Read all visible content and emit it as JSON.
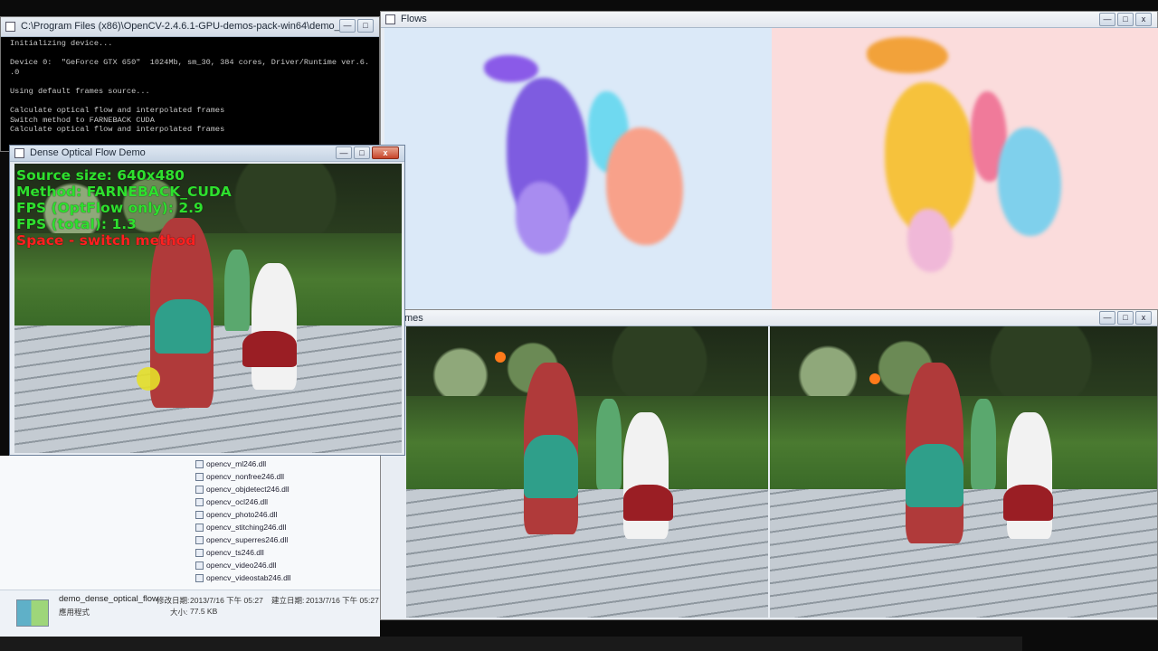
{
  "console": {
    "title": "C:\\Program Files (x86)\\OpenCV-2.4.6.1-GPU-demos-pack-win64\\demo_dense_optical_flow....",
    "lines": [
      "Initializing device...",
      "",
      "Device 0:  \"GeForce GTX 650\"  1024Mb, sm_30, 384 cores, Driver/Runtime ver.6.",
      ".0",
      "",
      "Using default frames source...",
      "",
      "Calculate optical flow and interpolated frames",
      "Switch method to FARNEBACK CUDA",
      "Calculate optical flow and interpolated frames"
    ]
  },
  "flows": {
    "title": "Flows"
  },
  "frames": {
    "title": "Frames",
    "title_visible": "mes"
  },
  "demo": {
    "title": "Dense Optical Flow Demo",
    "overlay": {
      "source_size": "Source size: 640x480",
      "method": "Method: FARNEBACK_CUDA",
      "fps_optflow": "FPS (OptFlow only): 2.9",
      "fps_total": "FPS (total): 1.3",
      "hint": "Space - switch method"
    }
  },
  "explorer": {
    "files": [
      "opencv_ml246.dll",
      "opencv_nonfree246.dll",
      "opencv_objdetect246.dll",
      "opencv_ocl246.dll",
      "opencv_photo246.dll",
      "opencv_stitching246.dll",
      "opencv_superres246.dll",
      "opencv_ts246.dll",
      "opencv_video246.dll",
      "opencv_videostab246.dll"
    ],
    "details": {
      "name": "demo_dense_optical_flow",
      "type": "應用程式",
      "modified_label": "修改日期:",
      "modified_value": "2013/7/16 下午 05:27",
      "created_label": "建立日期:",
      "created_value": "2013/7/16 下午 05:27",
      "size_label": "大小:",
      "size_value": "77.5 KB"
    }
  },
  "window_buttons": {
    "minimize": "—",
    "maximize": "□",
    "close": "x"
  },
  "icons": [
    "console-icon",
    "window-icon",
    "dll-file-icon",
    "application-thumbnail-icon"
  ]
}
